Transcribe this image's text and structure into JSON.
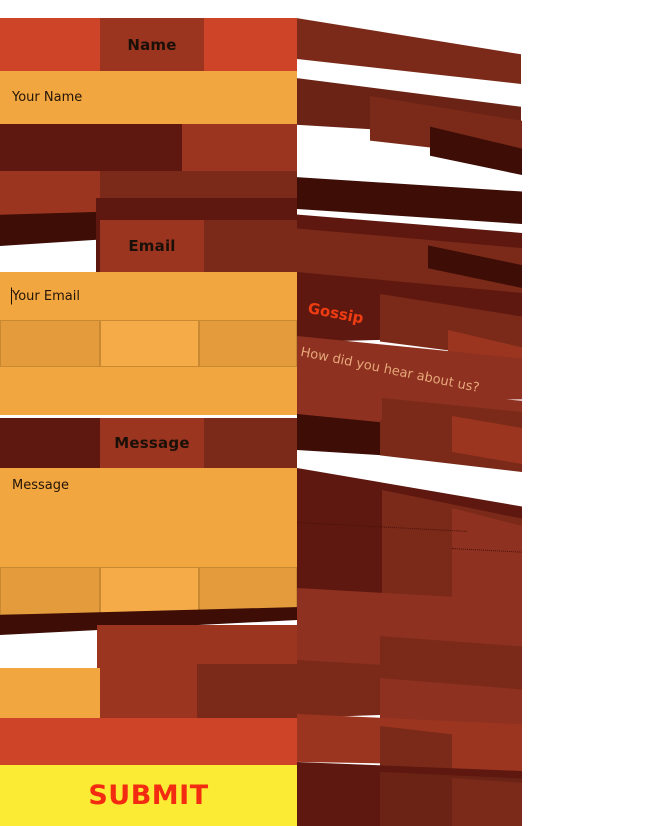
{
  "view": {
    "title": "3D Layered Form View",
    "type": "3d-dom-layer-view",
    "background": "#ffffff",
    "perspective_note": "Form layers extruded in depth, rotated to the right"
  },
  "palette": {
    "white": "#ffffff",
    "orange_field": "#f2a63f",
    "orange_field_dark": "#e39b3c",
    "orange_field_light": "#f5ab47",
    "red_band": "#ce4429",
    "brown_mid": "#9c3520",
    "brown_dark": "#7b2a19",
    "brown_deep": "#5e1810",
    "brown_deepest": "#3d0d06",
    "yellow_submit": "#fbeb34",
    "submit_text": "#f22b11",
    "gossip_text": "#f03c12",
    "hint_text": "#e7a87a",
    "label_text": "#1b1008"
  },
  "form": {
    "name_group": {
      "label": "Name",
      "input_placeholder": "Your Name",
      "input_value": ""
    },
    "email_group": {
      "label": "Email",
      "input_placeholder": "Your Email",
      "input_value": "",
      "has_caret": true
    },
    "gossip_group": {
      "label": "Gossip",
      "hint": "How did you hear about us?"
    },
    "message_group": {
      "label": "Message",
      "textarea_placeholder": "Message",
      "textarea_value": ""
    },
    "submit_button": {
      "label": "SUBMIT"
    }
  }
}
